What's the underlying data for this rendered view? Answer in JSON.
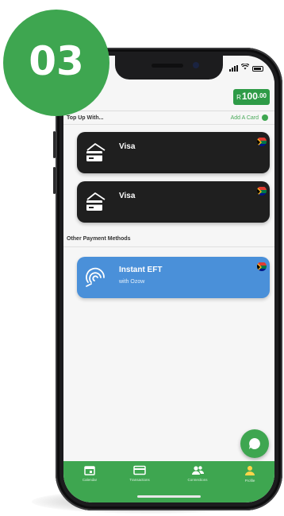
{
  "step_badge": "03",
  "status_bar": {
    "wifi_icon": "wifi-icon",
    "battery_icon": "battery-icon"
  },
  "header": {
    "balance_currency": "R",
    "balance_main": "100",
    "balance_cents": ".00",
    "search_icon": "search-icon"
  },
  "top_up": {
    "label": "Top Up With...",
    "add_card_label": "Add A Card"
  },
  "cards": [
    {
      "label": "Visa",
      "icon": "card-stack-icon"
    },
    {
      "label": "Visa",
      "icon": "card-stack-icon"
    }
  ],
  "other_methods": {
    "label": "Other Payment Methods",
    "eft_title": "Instant EFT",
    "eft_subtitle": "with Ozow",
    "eft_icon": "ozow-fingerprint-icon"
  },
  "bottom_nav": [
    {
      "label": "Calendar",
      "icon": "calendar-icon"
    },
    {
      "label": "Transactions",
      "icon": "card-icon"
    },
    {
      "label": "Connections",
      "icon": "people-icon"
    },
    {
      "label": "Profile",
      "icon": "person-icon"
    }
  ],
  "colors": {
    "brand_green": "#3ea650",
    "card_dark": "#1f1f1f",
    "eft_blue": "#4a90d9"
  }
}
